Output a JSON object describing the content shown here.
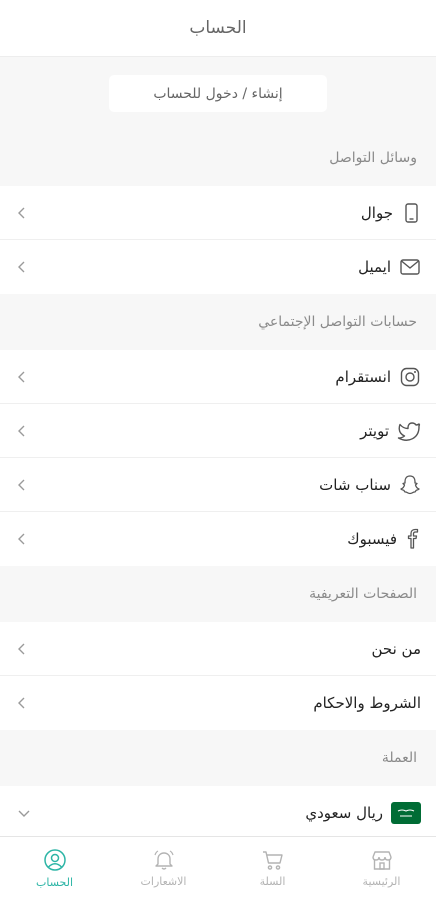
{
  "header": {
    "title": "الحساب"
  },
  "login": {
    "label": "إنشاء / دخول للحساب"
  },
  "contact": {
    "title": "وسائل التواصل",
    "items": [
      {
        "label": "جوال"
      },
      {
        "label": "ايميل"
      }
    ]
  },
  "social": {
    "title": "حسابات التواصل الإجتماعي",
    "items": [
      {
        "label": "انستقرام"
      },
      {
        "label": "تويتر"
      },
      {
        "label": "سناب شات"
      },
      {
        "label": "فيسبوك"
      }
    ]
  },
  "pages": {
    "title": "الصفحات التعريفية",
    "items": [
      {
        "label": "من نحن"
      },
      {
        "label": "الشروط والاحكام"
      }
    ]
  },
  "currency": {
    "title": "العملة",
    "selected": "ريال سعودي"
  },
  "tabs": [
    {
      "label": "الرئيسية",
      "icon": "store-icon"
    },
    {
      "label": "السلة",
      "icon": "cart-icon"
    },
    {
      "label": "الاشعارات",
      "icon": "bell-icon"
    },
    {
      "label": "الحساب",
      "icon": "user-icon",
      "active": true
    }
  ],
  "colors": {
    "accent": "#2db5a6",
    "flag": "#006c35"
  }
}
